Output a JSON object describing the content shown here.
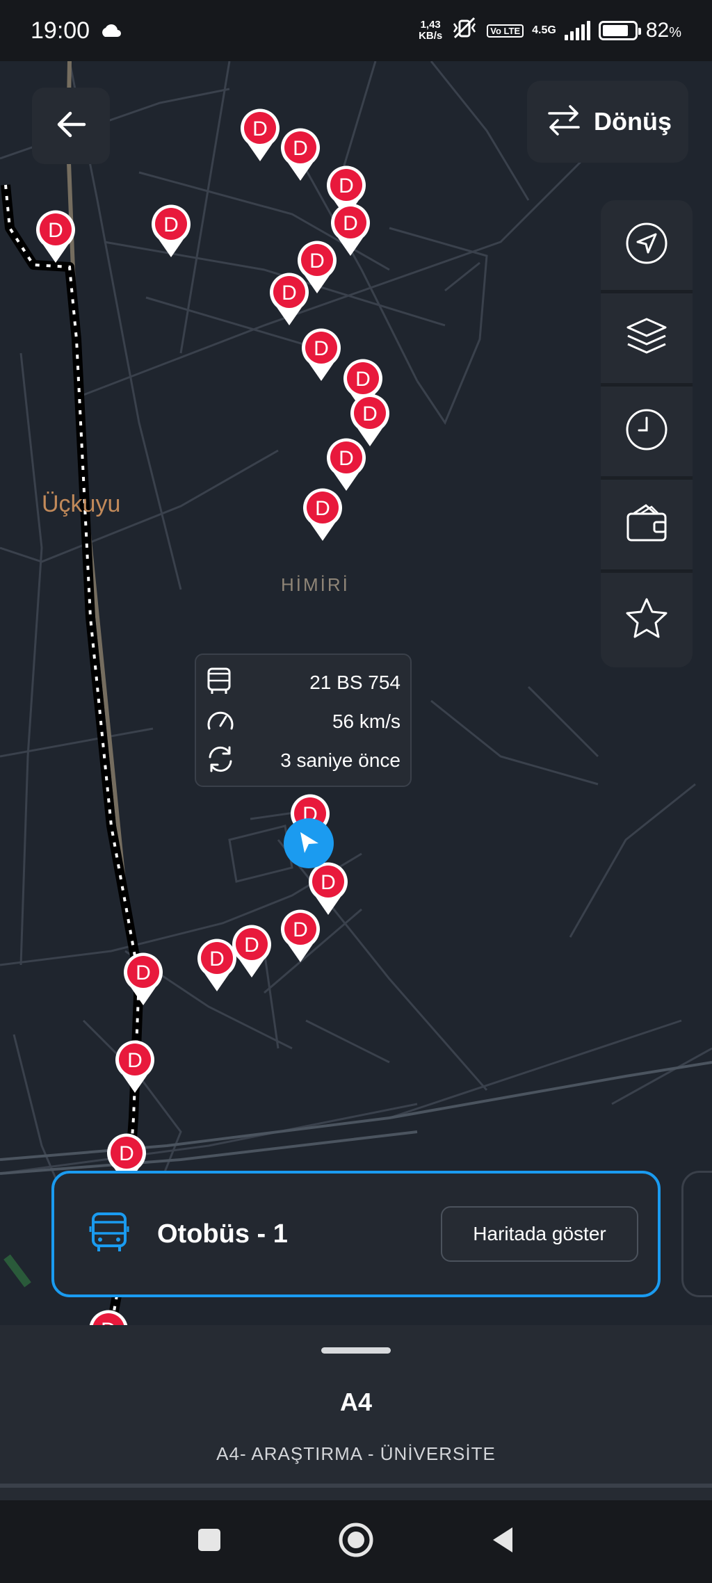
{
  "status_bar": {
    "time": "19:00",
    "net_speed_value": "1,43",
    "net_speed_unit": "KB/s",
    "volte": "Vo LTE",
    "network_type": "4.5G",
    "battery_percent": "82",
    "battery_unit": "%"
  },
  "map": {
    "place_labels": {
      "uckuyu": "Üçkuyu",
      "himiri": "HİMİRİ"
    },
    "stop_letter": "D",
    "colors": {
      "stop_pin": "#e8193c",
      "route_line": "#000000",
      "background": "#1f252e",
      "accent": "#1a9bf0"
    }
  },
  "toolbar": {
    "return_label": "Dönüş"
  },
  "vehicle_info": {
    "plate": "21 BS 754",
    "speed": "56 km/s",
    "updated": "3 saniye önce"
  },
  "bus_card": {
    "title": "Otobüs - 1",
    "show_on_map_label": "Haritada göster"
  },
  "route_sheet": {
    "code": "A4",
    "name": "A4- ARAŞTIRMA - ÜNİVERSİTE"
  }
}
